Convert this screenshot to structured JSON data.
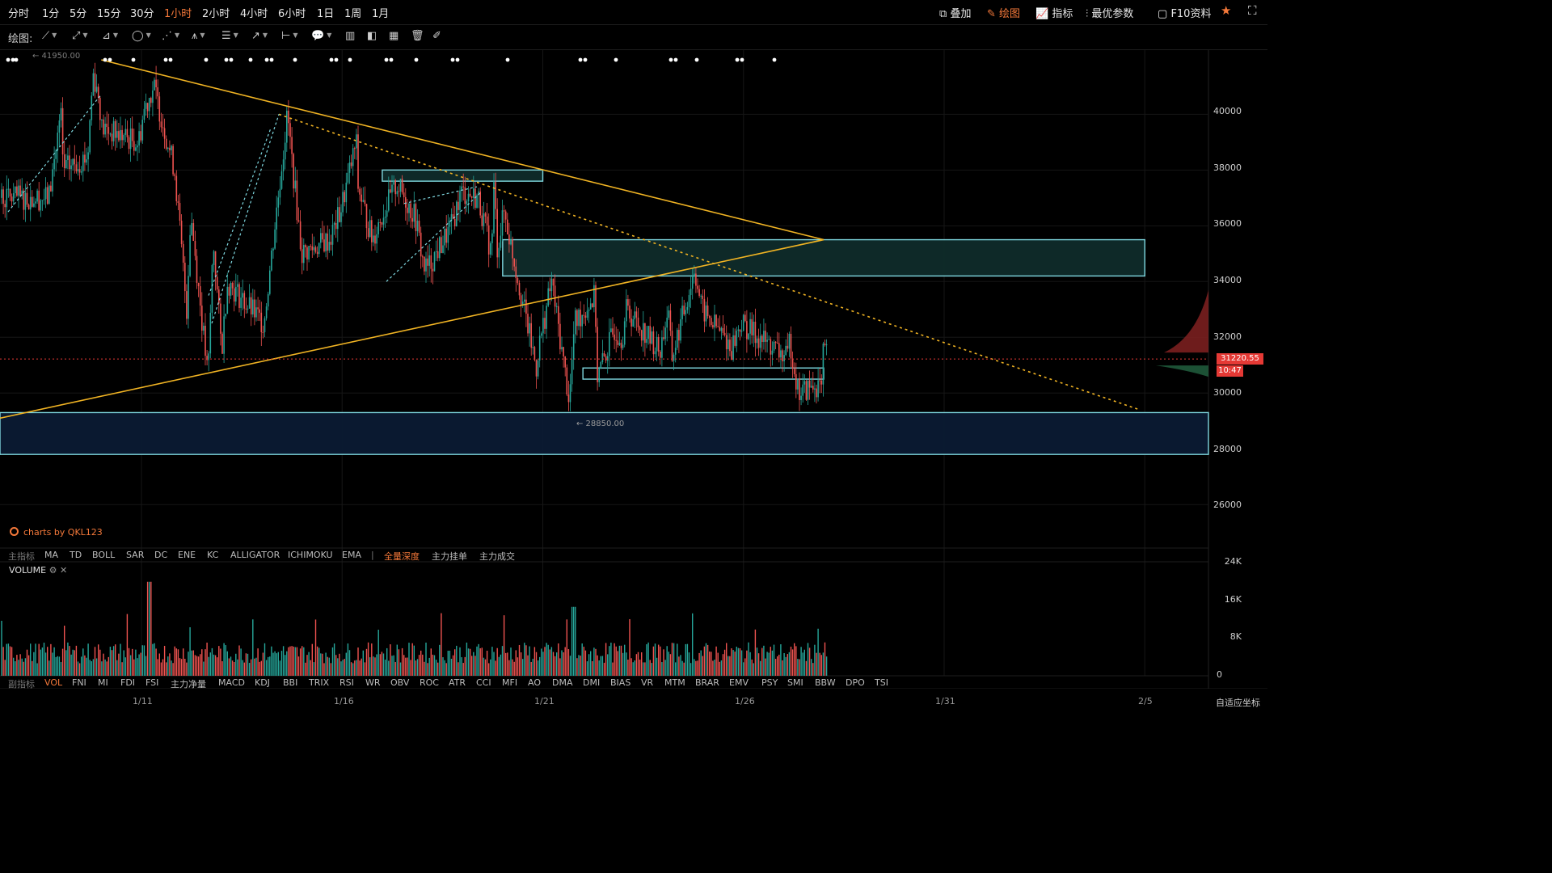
{
  "timeframes": [
    "分时",
    "1分",
    "5分",
    "15分",
    "30分",
    "1小时",
    "2小时",
    "4小时",
    "6小时",
    "1日",
    "1周",
    "1月"
  ],
  "active_timeframe": "1小时",
  "top_right": {
    "overlay": "叠加",
    "draw": "绘图",
    "indicators": "指标",
    "best_params": "最优参数",
    "f10": "F10资料"
  },
  "draw_label": "绘图:",
  "price_axis": [
    "40000",
    "38000",
    "36000",
    "34000",
    "32000",
    "30000",
    "28000",
    "26000"
  ],
  "annotations": {
    "high": "← 41950.00",
    "low": "← 28850.00"
  },
  "current_price": "31220.55",
  "countdown": "10:47",
  "watermark": "charts by QKL123",
  "main_indicators": {
    "label": "主指标",
    "items": [
      "MA",
      "TD",
      "BOLL",
      "SAR",
      "DC",
      "ENE",
      "KC",
      "ALLIGATOR",
      "ICHIMOKU",
      "EMA"
    ],
    "extra": [
      "全量深度",
      "主力挂单",
      "主力成交"
    ],
    "active": "全量深度"
  },
  "volume": {
    "title": "VOLUME",
    "axis": [
      "24K",
      "16K",
      "8K",
      "0"
    ]
  },
  "sub_indicators": {
    "label": "副指标",
    "items": [
      "VOL",
      "FNI",
      "MI",
      "FDI",
      "FSI",
      "主力净量",
      "MACD",
      "KDJ",
      "BBI",
      "TRIX",
      "RSI",
      "WR",
      "OBV",
      "ROC",
      "ATR",
      "CCI",
      "MFI",
      "AO",
      "DMA",
      "DMI",
      "BIAS",
      "VR",
      "MTM",
      "BRAR",
      "EMV",
      "PSY",
      "SMI",
      "BBW",
      "DPO",
      "TSI"
    ],
    "active": "VOL"
  },
  "date_axis": [
    "1/11",
    "1/16",
    "1/21",
    "1/26",
    "1/31",
    "2/5"
  ],
  "auto_scale": "自适应坐标",
  "colors": {
    "up": "#26a69a",
    "down": "#ef5350",
    "accent": "#f5793a",
    "trendline": "#f0b323",
    "zone": "#7fd8e0"
  },
  "chart_data": {
    "type": "candlestick",
    "timeframe": "1小时",
    "x_range": [
      "1/9",
      "2/6"
    ],
    "y_range": [
      24500,
      42300
    ],
    "high": 41950,
    "low": 28850,
    "last": 31220.55,
    "path": [
      [
        "1/9",
        40000
      ],
      [
        "1/9",
        38000
      ],
      [
        "1/9",
        37000
      ],
      [
        "1/10",
        41500
      ],
      [
        "1/10",
        40500
      ],
      [
        "1/10",
        39500
      ],
      [
        "1/10",
        38500
      ],
      [
        "1/11",
        41000
      ],
      [
        "1/11",
        40200
      ],
      [
        "1/11",
        39000
      ],
      [
        "1/12",
        38000
      ],
      [
        "1/12",
        36500
      ],
      [
        "1/12",
        33000
      ],
      [
        "1/13",
        30500
      ],
      [
        "1/13",
        31500
      ],
      [
        "1/13",
        35500
      ],
      [
        "1/13",
        34000
      ],
      [
        "1/14",
        33000
      ],
      [
        "1/14",
        32500
      ],
      [
        "1/15",
        35000
      ],
      [
        "1/15",
        38500
      ],
      [
        "1/15",
        40000
      ],
      [
        "1/16",
        39000
      ],
      [
        "1/16",
        37500
      ],
      [
        "1/16",
        35500
      ],
      [
        "1/16",
        36500
      ],
      [
        "1/17",
        37500
      ],
      [
        "1/17",
        35500
      ],
      [
        "1/17",
        36200
      ],
      [
        "1/18",
        34500
      ],
      [
        "1/18",
        34500
      ],
      [
        "1/18",
        36300
      ],
      [
        "1/19",
        36000
      ],
      [
        "1/19",
        37000
      ],
      [
        "1/19",
        37200
      ],
      [
        "1/20",
        37500
      ],
      [
        "1/20",
        36500
      ],
      [
        "1/20",
        35200
      ],
      [
        "1/20",
        35000
      ],
      [
        "1/21",
        34000
      ],
      [
        "1/21",
        31500
      ],
      [
        "1/21",
        30600
      ],
      [
        "1/22",
        29700
      ],
      [
        "1/22",
        30500
      ],
      [
        "1/22",
        32500
      ],
      [
        "1/22",
        33500
      ],
      [
        "1/23",
        32000
      ],
      [
        "1/23",
        32300
      ],
      [
        "1/23",
        33000
      ],
      [
        "1/24",
        31500
      ],
      [
        "1/24",
        31200
      ],
      [
        "1/24",
        33000
      ],
      [
        "1/25",
        34000
      ],
      [
        "1/25",
        34500
      ],
      [
        "1/25",
        33000
      ],
      [
        "1/26",
        31500
      ],
      [
        "1/26",
        31800
      ],
      [
        "1/26",
        32500
      ],
      [
        "1/27",
        32000
      ],
      [
        "1/27",
        31200
      ],
      [
        "1/27",
        30000
      ],
      [
        "1/28",
        30300
      ],
      [
        "1/28",
        30100
      ],
      [
        "1/28",
        31400
      ],
      [
        "1/28",
        31300
      ]
    ],
    "zones": [
      {
        "from": "1/17",
        "to": "1/21",
        "low": 37600,
        "high": 38000
      },
      {
        "from": "1/20",
        "to": "2/5",
        "low": 34200,
        "high": 35500
      },
      {
        "from": "1/22",
        "to": "1/28",
        "low": 30500,
        "high": 30900
      },
      {
        "from": "1/9",
        "to": "2/6",
        "low": 27800,
        "high": 29300
      }
    ],
    "trendlines": [
      {
        "style": "solid",
        "from": [
          "1/10",
          41950
        ],
        "to": [
          "1/28",
          35500
        ]
      },
      {
        "style": "solid",
        "from": [
          "1/9",
          29100
        ],
        "to": [
          "1/28",
          35500
        ]
      },
      {
        "style": "dotted",
        "from": [
          "1/15",
          40000
        ],
        "to": [
          "2/4",
          29400
        ]
      }
    ],
    "volume_range": [
      0,
      24000
    ]
  }
}
